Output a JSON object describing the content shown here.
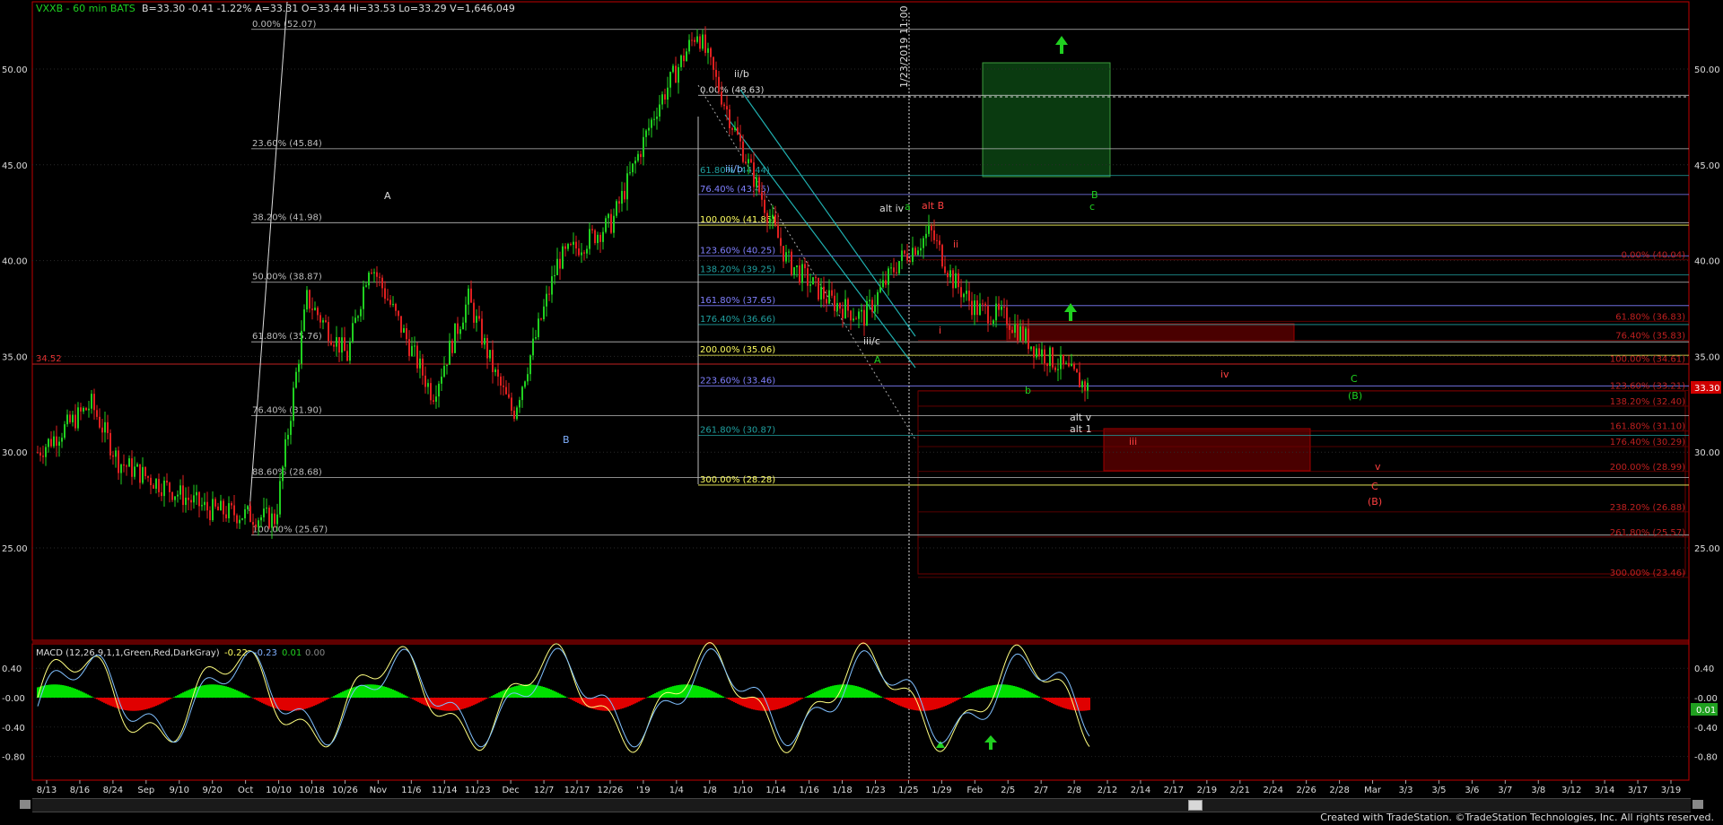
{
  "header": {
    "symbol": "VXXB - 60 min BATS",
    "quote": "B=33.30 -0.41 -1.22% A=33.31 O=33.44 Hi=33.53 Lo=33.29 V=1,646,049"
  },
  "price_axis": {
    "labels": [
      "50.00",
      "45.00",
      "40.00",
      "35.00",
      "30.00",
      "25.00"
    ],
    "current_price": "33.30",
    "ref_price": "34.52"
  },
  "date_axis": {
    "labels": [
      "8/13",
      "8/16",
      "8/24",
      "Sep",
      "9/10",
      "9/20",
      "Oct",
      "10/10",
      "10/18",
      "10/26",
      "Nov",
      "11/6",
      "11/14",
      "11/23",
      "Dec",
      "12/7",
      "12/17",
      "12/26",
      "'19",
      "1/4",
      "1/8",
      "1/10",
      "1/14",
      "1/16",
      "1/18",
      "1/23",
      "1/25",
      "1/29",
      "Feb",
      "2/5",
      "2/7",
      "2/8",
      "2/12",
      "2/14",
      "2/17",
      "2/19",
      "2/21",
      "2/24",
      "2/26",
      "2/28",
      "Mar",
      "3/3",
      "3/5",
      "3/6",
      "3/7",
      "3/8",
      "3/12",
      "3/14",
      "3/17",
      "3/19"
    ]
  },
  "macd": {
    "label": "MACD (12,26,9,1,1,Green,Red,DarkGray)",
    "values": [
      "-0.22",
      "-0.23",
      "0.01",
      "0.00"
    ],
    "axis_labels": [
      "0.40",
      "-0.00",
      "-0.40",
      "-0.80"
    ],
    "current": "0.01",
    "colors": {
      "positive": "#00e000",
      "negative": "#e00000"
    }
  },
  "vertical_marker": "1/23/2019 11:00",
  "fib_levels": {
    "left": [
      {
        "label": "0.00% (52.07)",
        "price": 52.07
      },
      {
        "label": "23.60% (45.84)",
        "price": 45.84
      },
      {
        "label": "38.20% (41.98)",
        "price": 41.98
      },
      {
        "label": "50.00% (38.87)",
        "price": 38.87
      },
      {
        "label": "61.80% (35.76)",
        "price": 35.76
      },
      {
        "label": "76.40% (31.90)",
        "price": 31.9
      },
      {
        "label": "88.60% (28.68)",
        "price": 28.68
      },
      {
        "label": "100.00% (25.67)",
        "price": 25.67
      }
    ],
    "mid": [
      {
        "label": "0.00% (48.63)",
        "price": 48.63,
        "color": "#dddddd"
      },
      {
        "label": "61.80% (44.44)",
        "price": 44.44,
        "color": "#20a0a0"
      },
      {
        "label": "76.40% (43.45)",
        "price": 43.45,
        "color": "#8080ff"
      },
      {
        "label": "100.00% (41.85)",
        "price": 41.85,
        "color": "#ffff60"
      },
      {
        "label": "123.60% (40.25)",
        "price": 40.25,
        "color": "#8080ff"
      },
      {
        "label": "138.20% (39.25)",
        "price": 39.25,
        "color": "#20a0a0"
      },
      {
        "label": "161.80% (37.65)",
        "price": 37.65,
        "color": "#8080ff"
      },
      {
        "label": "176.40% (36.66)",
        "price": 36.66,
        "color": "#20a0a0"
      },
      {
        "label": "200.00% (35.06)",
        "price": 35.06,
        "color": "#ffff60"
      },
      {
        "label": "223.60% (33.46)",
        "price": 33.46,
        "color": "#8080ff"
      },
      {
        "label": "261.80% (30.87)",
        "price": 30.87,
        "color": "#20a0a0"
      },
      {
        "label": "300.00% (28.28)",
        "price": 28.28,
        "color": "#ffff60"
      }
    ],
    "right": [
      {
        "label": "0.00% (40.04)",
        "price": 40.04
      },
      {
        "label": "61.80% (36.83)",
        "price": 36.83
      },
      {
        "label": "76.40% (35.83)",
        "price": 35.83
      },
      {
        "label": "100.00% (34.61)",
        "price": 34.61
      },
      {
        "label": "123.60% (33.21)",
        "price": 33.21
      },
      {
        "label": "138.20% (32.40)",
        "price": 32.4
      },
      {
        "label": "161.80% (31.10)",
        "price": 31.1
      },
      {
        "label": "176.40% (30.29)",
        "price": 30.29
      },
      {
        "label": "200.00% (28.99)",
        "price": 28.99
      },
      {
        "label": "238.20% (26.88)",
        "price": 26.88
      },
      {
        "label": "261.80% (25.57)",
        "price": 25.57
      },
      {
        "label": "300.00% (23.46)",
        "price": 23.46
      }
    ]
  },
  "annotations": {
    "A": "A",
    "B": "B",
    "iib": "ii/b",
    "iiib": "iii/b",
    "altiv": "alt iv",
    "a": "a",
    "altB": "alt B",
    "B_green": "B",
    "c_green": "c",
    "ii": "ii",
    "i": "i",
    "iiic": "iii/c",
    "A_green": "A",
    "b_green": "b",
    "iv": "iv",
    "C_green": "C",
    "B_paren_green": "(B)",
    "altv": "alt v",
    "alt1": "alt 1",
    "iii": "iii",
    "v": "v",
    "C_red": "C",
    "B_paren_red": "(B)"
  },
  "chart_data": {
    "type": "candlestick",
    "title": "VXXB - 60 min BATS",
    "ylim": [
      22,
      53
    ],
    "x_range": [
      "8/13",
      "3/19"
    ],
    "key_prices": {
      "high": 52.07,
      "low": 25.67,
      "last": 33.3
    },
    "series": [
      {
        "name": "VXXB",
        "approx_path": [
          [
            0,
            30
          ],
          [
            60,
            32.5
          ],
          [
            90,
            29.5
          ],
          [
            190,
            27
          ],
          [
            265,
            26.5
          ],
          [
            300,
            38
          ],
          [
            345,
            35
          ],
          [
            370,
            40
          ],
          [
            410,
            36
          ],
          [
            440,
            33
          ],
          [
            480,
            38
          ],
          [
            510,
            34
          ],
          [
            530,
            32
          ],
          [
            580,
            40
          ],
          [
            640,
            42
          ],
          [
            690,
            48
          ],
          [
            735,
            52
          ],
          [
            775,
            47
          ],
          [
            835,
            40
          ],
          [
            880,
            38
          ],
          [
            920,
            37
          ],
          [
            960,
            40
          ],
          [
            995,
            41.5
          ],
          [
            1020,
            39
          ],
          [
            1045,
            37.5
          ],
          [
            1080,
            37
          ],
          [
            1110,
            35.5
          ],
          [
            1140,
            34.5
          ],
          [
            1172,
            33.3
          ]
        ]
      }
    ]
  },
  "footer": "Created with TradeStation. ©TradeStation Technologies, Inc. All rights reserved."
}
